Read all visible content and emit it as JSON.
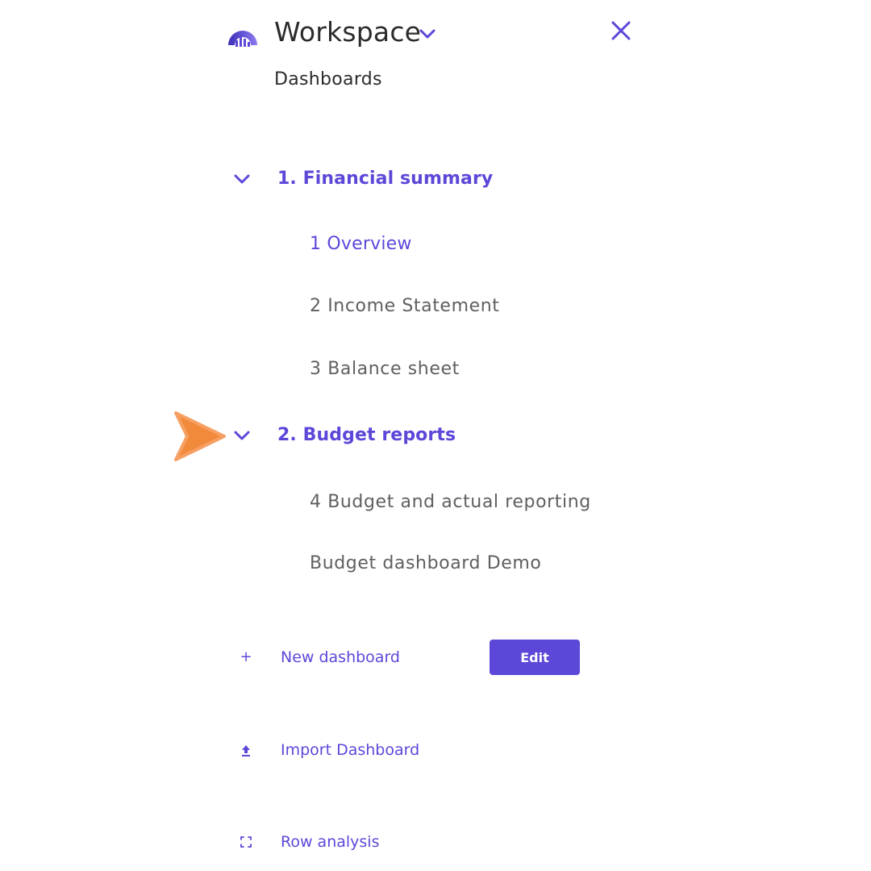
{
  "header": {
    "workspace_label": "Workspace",
    "icons": {
      "logo": "workspace-logo",
      "dropdown": "chevron-down-icon",
      "close": "close-icon"
    }
  },
  "section": {
    "title": "Dashboards"
  },
  "groups": [
    {
      "label": "1. Financial summary",
      "expanded": true,
      "items": [
        {
          "label": "1 Overview",
          "active": true
        },
        {
          "label": "2 Income Statement",
          "active": false
        },
        {
          "label": "3 Balance sheet",
          "active": false
        }
      ]
    },
    {
      "label": "2. Budget reports",
      "expanded": true,
      "items": [
        {
          "label": "4 Budget and actual reporting",
          "active": false
        },
        {
          "label": "Budget dashboard Demo",
          "active": false
        }
      ]
    }
  ],
  "actions": {
    "new_dashboard": {
      "label": "New dashboard",
      "icon": "plus-icon"
    },
    "edit": {
      "label": "Edit"
    },
    "import_dashboard": {
      "label": "Import Dashboard",
      "icon": "upload-icon"
    },
    "row_analysis": {
      "label": "Row analysis",
      "icon": "expand-icon"
    }
  },
  "colors": {
    "accent": "#5b48d9",
    "text_dark": "#2b2b2b",
    "text_muted": "#5f5f5f",
    "pointer": "#f28a3c"
  }
}
